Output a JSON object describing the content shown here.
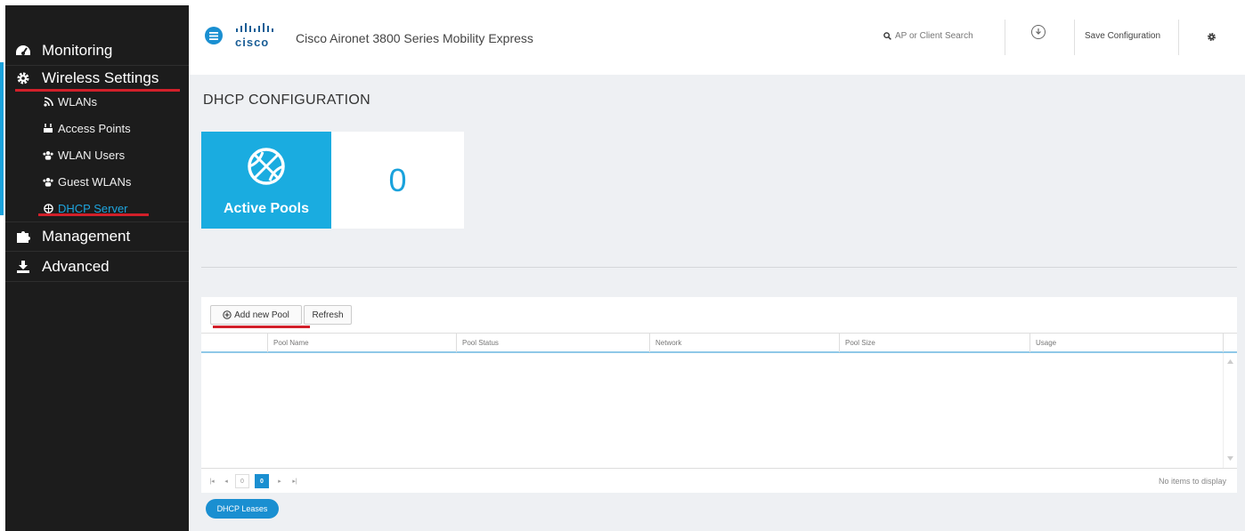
{
  "sidebar": {
    "monitoring": "Monitoring",
    "wireless_settings": "Wireless Settings",
    "sub_items": [
      {
        "label": "WLANs",
        "icon": "wifi-icon"
      },
      {
        "label": "Access Points",
        "icon": "access-point-icon"
      },
      {
        "label": "WLAN Users",
        "icon": "users-icon"
      },
      {
        "label": "Guest WLANs",
        "icon": "users-icon"
      },
      {
        "label": "DHCP Server",
        "icon": "globe-icon"
      }
    ],
    "management": "Management",
    "advanced": "Advanced",
    "active_color": "#1ea4dd",
    "highlight_color": "#d2202a"
  },
  "header": {
    "brand": "cisco",
    "title": "Cisco Aironet 3800 Series Mobility Express",
    "search_placeholder": "AP or Client Search",
    "save_label": "Save Configuration"
  },
  "page": {
    "title": "DHCP CONFIGURATION",
    "tile_label": "Active Pools",
    "tile_value": "0"
  },
  "grid": {
    "add_button": "Add new Pool",
    "refresh_button": "Refresh",
    "columns": [
      "Pool Name",
      "Pool Status",
      "Network",
      "Pool Size",
      "Usage"
    ],
    "current_page": "0",
    "page_input": "0",
    "empty_text": "No items to display"
  },
  "footer": {
    "leases_button": "DHCP Leases"
  }
}
